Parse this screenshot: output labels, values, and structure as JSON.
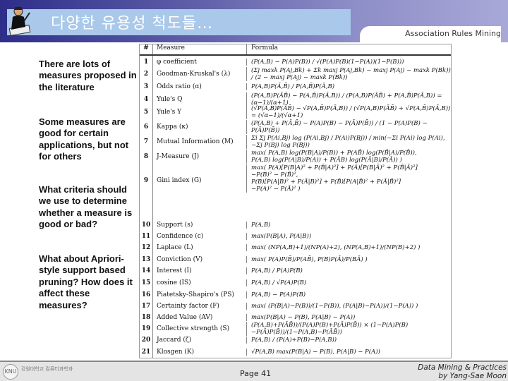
{
  "header": {
    "title": "다양한 유용성 척도들…",
    "subject": "Association Rules Mining"
  },
  "left_text": [
    "There are lots of measures proposed in the literature",
    "Some measures are good for certain applications, but not for others",
    "What criteria should we use to determine whether a measure is good or bad?",
    "What about Apriori-style support based pruning? How does it affect these measures?"
  ],
  "table": {
    "headers": [
      "#",
      "Measure",
      "Formula"
    ],
    "rows": [
      {
        "n": "1",
        "m": "φ coefficient",
        "f": "(P(A,B) − P(A)P(B)) / √(P(A)P(B)(1−P(A))(1−P(B)))"
      },
      {
        "n": "2",
        "m": "Goodman-Kruskal's (λ)",
        "f": "(Σj maxk P(Aj,Bk) + Σk maxj P(Aj,Bk) − maxj P(Aj) − maxk P(Bk)) / (2 − maxj P(Aj) − maxk P(Bk))"
      },
      {
        "n": "3",
        "m": "Odds ratio (α)",
        "f": "P(A,B)P(Ā,B̄) / P(A,B̄)P(Ā,B)"
      },
      {
        "n": "4",
        "m": "Yule's Q",
        "f": "(P(A,B)P(ĀB̄) − P(A,B̄)P(Ā,B)) / (P(A,B)P(ĀB̄) + P(A,B̄)P(Ā,B)) = (α−1)/(α+1)"
      },
      {
        "n": "5",
        "m": "Yule's Y",
        "f": "(√P(A,B)P(ĀB̄) − √P(A,B̄)P(Ā,B)) / (√P(A,B)P(ĀB̄) + √P(A,B̄)P(Ā,B)) = (√α−1)/(√α+1)"
      },
      {
        "n": "6",
        "m": "Kappa (κ)",
        "f": "(P(A,B) + P(Ā,B̄) − P(A)P(B) − P(Ā)P(B̄)) / (1 − P(A)P(B) − P(Ā)P(B̄))"
      },
      {
        "n": "7",
        "m": "Mutual Information (M)",
        "f": "Σi Σj P(Ai,Bj) log (P(Ai,Bj) / P(Ai)P(Bj)) / min(−Σi P(Ai) log P(Ai), −Σj P(Bj) log P(Bj))"
      },
      {
        "n": "8",
        "m": "J-Measure (J)",
        "f": "max( P(A,B) log(P(B|A)/P(B)) + P(AB̄) log(P(B̄|A)/P(B̄)),\nP(A,B) log(P(A|B)/P(A)) + P(ĀB) log(P(Ā|B)/P(Ā)) )"
      },
      {
        "n": "9",
        "m": "Gini index (G)",
        "f": "max( P(A)[P(B|A)² + P(B̄|A)²] + P(Ā)[P(B|Ā)² + P(B̄|Ā)²]\n−P(B)² − P(B̄)²,\nP(B)[P(A|B)² + P(Ā|B)²] + P(B̄)[P(A|B̄)² + P(Ā|B̄)²]\n−P(A)² − P(Ā)² )"
      },
      {
        "n": "10",
        "m": "Support (s)",
        "f": "P(A,B)"
      },
      {
        "n": "11",
        "m": "Confidence (c)",
        "f": "max(P(B|A), P(A|B))"
      },
      {
        "n": "12",
        "m": "Laplace (L)",
        "f": "max( (NP(A,B)+1)/(NP(A)+2), (NP(A,B)+1)/(NP(B)+2) )"
      },
      {
        "n": "13",
        "m": "Conviction (V)",
        "f": "max( P(A)P(B̄)/P(AB̄), P(B)P(Ā)/P(BĀ) )"
      },
      {
        "n": "14",
        "m": "Interest (I)",
        "f": "P(A,B) / P(A)P(B)"
      },
      {
        "n": "15",
        "m": "cosine (IS)",
        "f": "P(A,B) / √P(A)P(B)"
      },
      {
        "n": "16",
        "m": "Piatetsky-Shapiro's (PS)",
        "f": "P(A,B) − P(A)P(B)"
      },
      {
        "n": "17",
        "m": "Certainty factor (F)",
        "f": "max( (P(B|A)−P(B))/(1−P(B)), (P(A|B)−P(A))/(1−P(A)) )"
      },
      {
        "n": "18",
        "m": "Added Value (AV)",
        "f": "max(P(B|A) − P(B), P(A|B) − P(A))"
      },
      {
        "n": "19",
        "m": "Collective strength (S)",
        "f": "(P(A,B)+P(ĀB̄))/(P(A)P(B)+P(Ā)P(B̄)) × (1−P(A)P(B)−P(Ā)P(B̄))/(1−P(A,B)−P(ĀB̄))"
      },
      {
        "n": "20",
        "m": "Jaccard (ζ)",
        "f": "P(A,B) / (P(A)+P(B)−P(A,B))"
      },
      {
        "n": "21",
        "m": "Klosgen (K)",
        "f": "√P(A,B) max(P(B|A) − P(B), P(A|B) − P(A))"
      }
    ]
  },
  "footer": {
    "logo_text": "강원대학교 컴퓨터과학과",
    "page": "Page 41",
    "credit_line1": "Data Mining & Practices",
    "credit_line2": "by Yang-Sae Moon"
  }
}
